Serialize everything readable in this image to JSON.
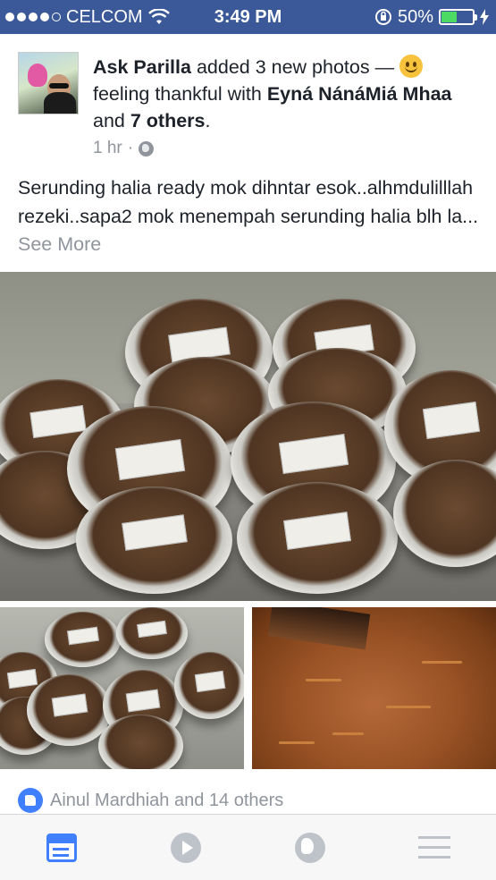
{
  "status_bar": {
    "carrier": "CELCOM",
    "time": "3:49 PM",
    "battery_percent": "50%",
    "battery_level": 0.5
  },
  "post": {
    "author": "Ask Parilla",
    "action": " added 3 new photos — ",
    "feeling": " feeling thankful with ",
    "tagged_user": "Eyná NánáMiá Mhaa",
    "and_text": " and ",
    "others": "7 others",
    "period": ".",
    "time_ago": "1 hr",
    "separator": "·",
    "body": "Serunding halia ready mok dihntar esok..alhmdulilllah rezeki..sapa2 mok menempah serunding halia blh la... ",
    "see_more": "See More"
  },
  "likes": {
    "text": "Ainul Mardhiah and 14 others"
  },
  "tab_bar": {
    "items": [
      "news-feed",
      "video",
      "notifications-globe",
      "menu"
    ]
  },
  "colors": {
    "brand": "#3b5998",
    "accent": "#4080ff",
    "muted": "#90949c"
  }
}
